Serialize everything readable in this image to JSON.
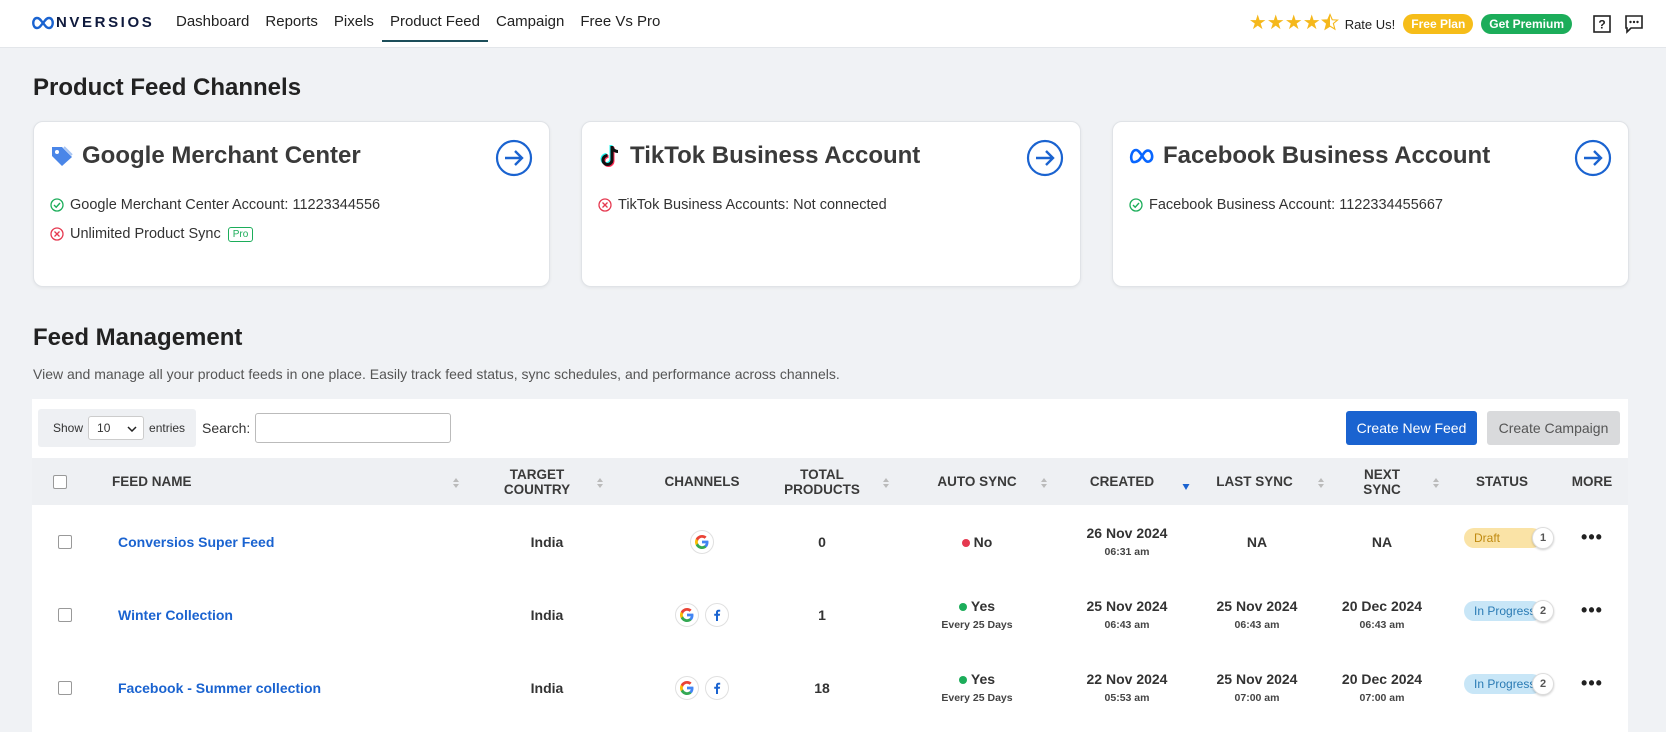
{
  "brand": {
    "logo_text": "NVERSIOS"
  },
  "nav": {
    "items": [
      "Dashboard",
      "Reports",
      "Pixels",
      "Product Feed",
      "Campaign",
      "Free Vs Pro"
    ],
    "active": "Product Feed"
  },
  "header_tools": {
    "rating_stars": 4.5,
    "rate_text": "Rate Us!",
    "free_plan": "Free Plan",
    "get_premium": "Get Premium"
  },
  "channels_section": {
    "title": "Product Feed Channels"
  },
  "cards": {
    "google": {
      "title": "Google Merchant Center",
      "line1": "Google Merchant Center Account: 11223344556",
      "line2": "Unlimited Product Sync",
      "badge": "Pro"
    },
    "tiktok": {
      "title": "TikTok Business Account",
      "line1": "TikTok Business Accounts: Not connected"
    },
    "facebook": {
      "title": "Facebook Business Account",
      "line1": "Facebook Business Account: 1122334455667"
    }
  },
  "feed_section": {
    "title": "Feed Management",
    "description": "View and manage all your product feeds in one place. Easily track feed status, sync schedules, and performance across channels."
  },
  "toolbar": {
    "show_label": "Show",
    "entries_value": "10",
    "entries_label": "entries",
    "search_label": "Search:",
    "search_placeholder": "",
    "create_feed": "Create New Feed",
    "create_campaign": "Create Campaign"
  },
  "columns": {
    "feed_name": "FEED NAME",
    "target_country_1": "TARGET",
    "target_country_2": "COUNTRY",
    "channels": "CHANNELS",
    "total_products_1": "TOTAL",
    "total_products_2": "PRODUCTS",
    "auto_sync": "AUTO SYNC",
    "created": "CREATED",
    "last_sync": "LAST SYNC",
    "next_sync_1": "NEXT",
    "next_sync_2": "SYNC",
    "status": "STATUS",
    "more": "MORE"
  },
  "rows": [
    {
      "name": "Conversios Super Feed",
      "country": "India",
      "channels": [
        "google"
      ],
      "products": "0",
      "auto_sync": "No",
      "auto_sync_interval": "",
      "created_date": "26 Nov 2024",
      "created_time": "06:31 am",
      "last_sync_date": "NA",
      "last_sync_time": "",
      "next_sync_date": "NA",
      "next_sync_time": "",
      "status": "Draft",
      "status_count": "1"
    },
    {
      "name": "Winter Collection",
      "country": "India",
      "channels": [
        "google",
        "facebook"
      ],
      "products": "1",
      "auto_sync": "Yes",
      "auto_sync_interval": "Every 25 Days",
      "created_date": "25 Nov 2024",
      "created_time": "06:43 am",
      "last_sync_date": "25 Nov 2024",
      "last_sync_time": "06:43 am",
      "next_sync_date": "20 Dec 2024",
      "next_sync_time": "06:43 am",
      "status": "In Progress",
      "status_count": "2"
    },
    {
      "name": "Facebook - Summer collection",
      "country": "India",
      "channels": [
        "google",
        "facebook"
      ],
      "products": "18",
      "auto_sync": "Yes",
      "auto_sync_interval": "Every 25 Days",
      "created_date": "22 Nov 2024",
      "created_time": "05:53 am",
      "last_sync_date": "25 Nov 2024",
      "last_sync_time": "07:00 am",
      "next_sync_date": "20 Dec 2024",
      "next_sync_time": "07:00 am",
      "status": "In Progress",
      "status_count": "2"
    }
  ],
  "colors": {
    "accent": "#1a63d0",
    "free_plan": "#f6bd19",
    "premium": "#1cad5a",
    "star": "#f5b81c"
  }
}
